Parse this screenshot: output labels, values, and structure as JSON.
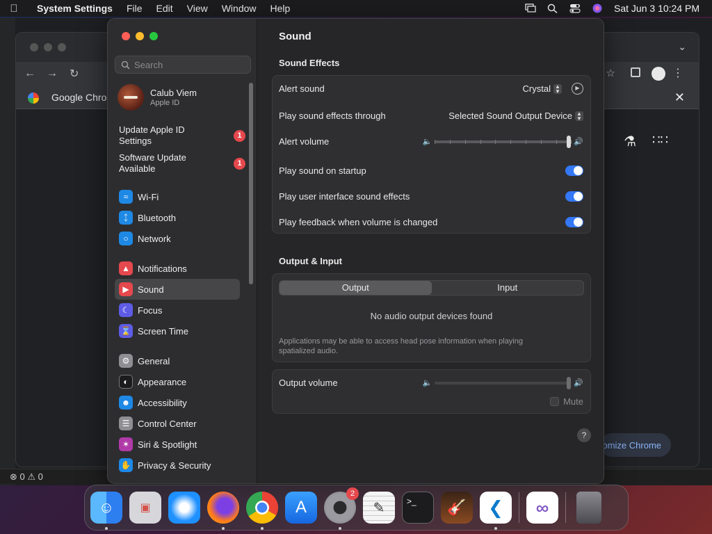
{
  "menubar": {
    "app_name": "System Settings",
    "menus": [
      "File",
      "Edit",
      "View",
      "Window",
      "Help"
    ],
    "clock": "Sat Jun 3  10:24 PM"
  },
  "background": {
    "chrome_bookmark": "Google Chrom",
    "chrome_customize": "tomize Chrome",
    "vscode_status": "⊗ 0 ⚠ 0"
  },
  "sidebar": {
    "search_placeholder": "Search",
    "profile_name": "Calub Viem",
    "profile_sub": "Apple ID",
    "notices": [
      {
        "label": "Update Apple ID Settings",
        "badge": "1"
      },
      {
        "label": "Software Update Available",
        "badge": "1"
      }
    ],
    "items": [
      {
        "label": "Wi-Fi",
        "icon": "wifi-icon",
        "color": "#1e88e5"
      },
      {
        "label": "Bluetooth",
        "icon": "bluetooth-icon",
        "color": "#1e88e5"
      },
      {
        "label": "Network",
        "icon": "globe-icon",
        "color": "#1e88e5"
      },
      {
        "label": "Notifications",
        "icon": "bell-icon",
        "color": "#e5484d"
      },
      {
        "label": "Sound",
        "icon": "speaker-icon",
        "color": "#e5484d"
      },
      {
        "label": "Focus",
        "icon": "moon-icon",
        "color": "#5e5ce6"
      },
      {
        "label": "Screen Time",
        "icon": "hourglass-icon",
        "color": "#5e5ce6"
      },
      {
        "label": "General",
        "icon": "gear-icon",
        "color": "#8e8e93"
      },
      {
        "label": "Appearance",
        "icon": "appearance-icon",
        "color": "#1c1c1e"
      },
      {
        "label": "Accessibility",
        "icon": "accessibility-icon",
        "color": "#1e88e5"
      },
      {
        "label": "Control Center",
        "icon": "control-center-icon",
        "color": "#8e8e93"
      },
      {
        "label": "Siri & Spotlight",
        "icon": "siri-icon",
        "color": "#b03aa8"
      },
      {
        "label": "Privacy & Security",
        "icon": "hand-icon",
        "color": "#1e88e5"
      }
    ]
  },
  "main": {
    "title": "Sound",
    "sound_effects": {
      "heading": "Sound Effects",
      "alert_sound_label": "Alert sound",
      "alert_sound_value": "Crystal",
      "output_through_label": "Play sound effects through",
      "output_through_value": "Selected Sound Output Device",
      "alert_volume_label": "Alert volume",
      "alert_volume_level": 1.0,
      "startup_label": "Play sound on startup",
      "ui_effects_label": "Play user interface sound effects",
      "feedback_label": "Play feedback when volume is changed"
    },
    "output_input": {
      "heading": "Output & Input",
      "tab_output": "Output",
      "tab_input": "Input",
      "empty": "No audio output devices found",
      "note": "Applications may be able to access head pose information when playing spatialized audio.",
      "output_volume_label": "Output volume",
      "output_volume_level": 1.0,
      "mute_label": "Mute"
    }
  },
  "dock": {
    "apps": [
      {
        "name": "finder-icon",
        "color": "#2d8cf0"
      },
      {
        "name": "launchpad-icon",
        "color": "#cfcfd4"
      },
      {
        "name": "safari-icon",
        "color": "#1e90ff"
      },
      {
        "name": "firefox-icon",
        "color": "#ff7a1a"
      },
      {
        "name": "chrome-icon",
        "color": "#e8eaed"
      },
      {
        "name": "app-store-icon",
        "color": "#1e88e5"
      },
      {
        "name": "system-settings-icon",
        "color": "#8e8e93",
        "badge": "2"
      },
      {
        "name": "textedit-icon",
        "color": "#efefef"
      },
      {
        "name": "terminal-icon",
        "color": "#1c1c1e"
      },
      {
        "name": "garageband-icon",
        "color": "#6b3a1f"
      },
      {
        "name": "vscode-icon",
        "color": "#ffffff"
      },
      {
        "name": "visual-studio-icon",
        "color": "#ffffff"
      },
      {
        "name": "trash-icon",
        "color": "#5a5a5f"
      }
    ]
  }
}
